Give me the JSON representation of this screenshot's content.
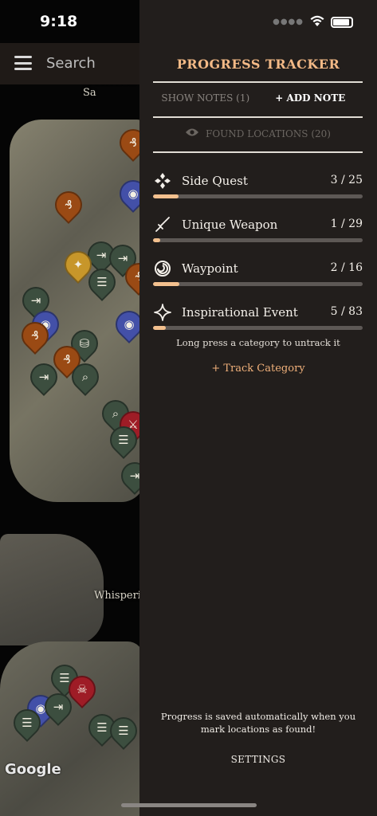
{
  "status_bar": {
    "time": "9:18"
  },
  "search": {
    "placeholder": "Search"
  },
  "map": {
    "labels": [
      "Shattered Sa",
      "Whisperin"
    ],
    "attribution": "Google"
  },
  "drawer": {
    "title": "PROGRESS TRACKER",
    "show_notes": "SHOW NOTES (1)",
    "add_note": "+ ADD NOTE",
    "found_locations": "FOUND LOCATIONS (20)",
    "categories": [
      {
        "name": "Side Quest",
        "count": "3 / 25",
        "icon": "diamond-cluster-icon",
        "progress": 0.12
      },
      {
        "name": "Unique Weapon",
        "count": "1 / 29",
        "icon": "dagger-icon",
        "progress": 0.034
      },
      {
        "name": "Waypoint",
        "count": "2 / 16",
        "icon": "swirl-icon",
        "progress": 0.125
      },
      {
        "name": "Inspirational Event",
        "count": "5 / 83",
        "icon": "sparkle-icon",
        "progress": 0.06
      }
    ],
    "hint": "Long press a category to untrack it",
    "track_category": "+ Track Category",
    "footer_note": "Progress is saved automatically when you mark locations as found!",
    "settings": "SETTINGS"
  },
  "colors": {
    "accent": "#f3b986",
    "drawer_bg": "#221e1c",
    "progress_fill": "#f3c08e",
    "progress_track": "#5d5855"
  }
}
